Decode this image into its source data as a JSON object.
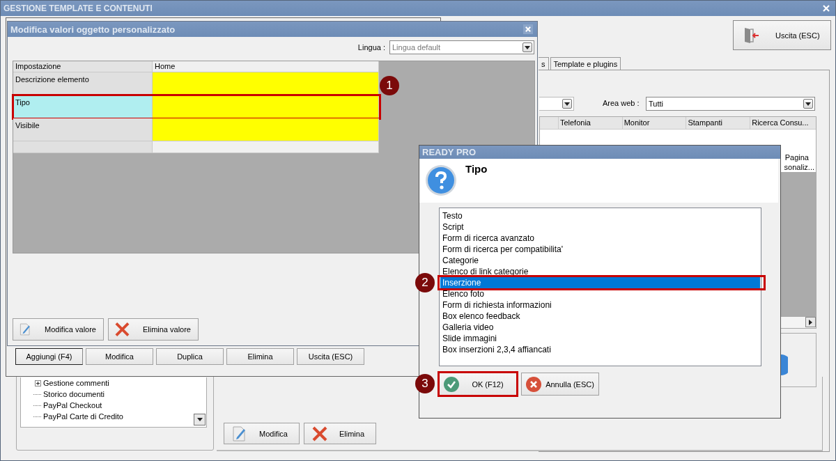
{
  "main_window": {
    "title": "GESTIONE TEMPLATE E CONTENUTI",
    "exit_button": "Uscita (ESC)",
    "tabs": [
      {
        "label": "s",
        "selected": false
      },
      {
        "label": "Template e plugins",
        "selected": false
      }
    ],
    "area_web_label": "Area web :",
    "area_web_value": "Tutti",
    "grid_columns": [
      "Telefonia",
      "Monitor",
      "Stampanti",
      "Ricerca Consu..."
    ],
    "grid_cell_lines": [
      "Pagina",
      "sonaliz..."
    ],
    "tree": [
      {
        "label": "Gestione commenti",
        "expandable": true
      },
      {
        "label": "Storico documenti",
        "expandable": false
      },
      {
        "label": "PayPal Checkout",
        "expandable": false
      },
      {
        "label": "PayPal Carte di Credito",
        "expandable": false
      }
    ],
    "buttons": [
      {
        "label": "Modifica",
        "kind": "edit"
      },
      {
        "label": "Elimina",
        "kind": "delete"
      }
    ]
  },
  "list_window": {
    "buttons": [
      {
        "label": "Aggiungi (F4)",
        "default": true
      },
      {
        "label": "Modifica",
        "default": false
      },
      {
        "label": "Duplica",
        "default": false
      },
      {
        "label": "Elimina",
        "default": false
      },
      {
        "label": "Uscita (ESC)",
        "default": false
      }
    ]
  },
  "edit_dialog": {
    "title": "Modifica valori oggetto personalizzato",
    "language_label": "Lingua :",
    "language_value": "Lingua default",
    "columns": [
      "Impostazione",
      "Home"
    ],
    "rows": [
      {
        "label": "Descrizione elemento",
        "selected": false
      },
      {
        "label": "Tipo",
        "selected": true,
        "badge": "1"
      },
      {
        "label": "Visibile",
        "selected": false
      }
    ],
    "buttons": [
      {
        "label": "Modifica valore",
        "kind": "edit"
      },
      {
        "label": "Elimina valore",
        "kind": "delete"
      }
    ]
  },
  "prompt_dialog": {
    "title": "READY PRO",
    "question": "Tipo",
    "options": [
      {
        "label": "Testo",
        "selected": false
      },
      {
        "label": "Script",
        "selected": false
      },
      {
        "label": "Form di ricerca avanzato",
        "selected": false
      },
      {
        "label": "Form di ricerca per compatibilita'",
        "selected": false
      },
      {
        "label": "Categorie",
        "selected": false
      },
      {
        "label": "Elenco di link categorie",
        "selected": false
      },
      {
        "label": "Inserzione",
        "selected": true,
        "badge": "2"
      },
      {
        "label": "Elenco foto",
        "selected": false
      },
      {
        "label": "Form di richiesta informazioni",
        "selected": false
      },
      {
        "label": "Box elenco feedback",
        "selected": false
      },
      {
        "label": "Galleria video",
        "selected": false
      },
      {
        "label": "Slide immagini",
        "selected": false
      },
      {
        "label": "Box inserzioni 2,3,4 affiancati",
        "selected": false
      }
    ],
    "buttons": [
      {
        "label": "OK (F12)",
        "kind": "ok",
        "badge": "3"
      },
      {
        "label": "Annulla (ESC)",
        "kind": "cancel"
      }
    ]
  }
}
